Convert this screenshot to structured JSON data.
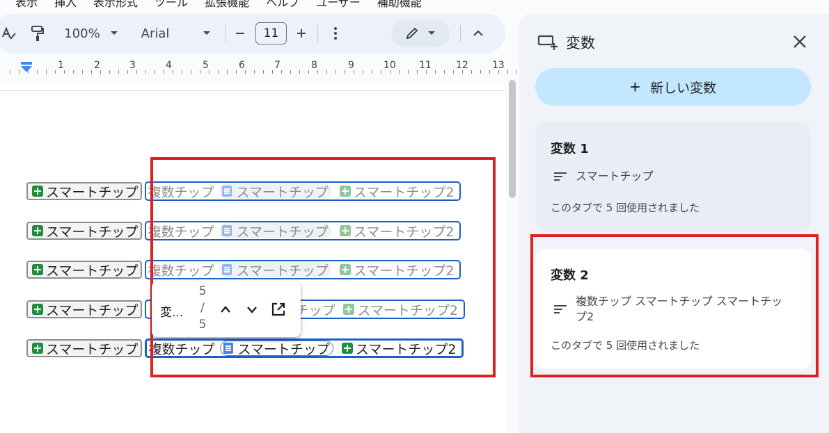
{
  "menu": [
    "表示",
    "挿入",
    "表示形式",
    "ツール",
    "拡張機能",
    "ヘルプ",
    "ユーザー",
    "補助機能"
  ],
  "toolbar": {
    "zoom": "100%",
    "font": "Arial",
    "font_size": "11",
    "icons": [
      "spellcheck-icon",
      "paint-format-icon",
      "minus-icon",
      "plus-icon",
      "more-vert-icon",
      "pencil-icon",
      "chevron-up-icon"
    ]
  },
  "ruler": {
    "numbers": [
      "1",
      "2",
      "3",
      "4",
      "5",
      "6",
      "7",
      "8",
      "9",
      "10",
      "11",
      "12",
      "13"
    ]
  },
  "document": {
    "rows": [
      {
        "chip": "スマートチップ",
        "multi": "複数チップ",
        "sub1": "スマートチップ",
        "sub2": "スマートチップ2"
      },
      {
        "chip": "スマートチップ",
        "multi": "複数チップ",
        "sub1": "スマートチップ",
        "sub2": "スマートチップ2"
      },
      {
        "chip": "スマートチップ",
        "multi": "複数チップ",
        "sub1": "スマートチップ",
        "sub2": "スマートチップ2"
      },
      {
        "chip": "スマートチップ",
        "multi": "チップ",
        "sub1": "",
        "sub2": "スマートチップ2"
      },
      {
        "chip": "スマートチップ",
        "multi": "複数チップ",
        "sub1": "スマートチップ",
        "sub2": "スマートチップ2"
      }
    ]
  },
  "find_popup": {
    "label": "変...",
    "count_current": "5",
    "count_sep": "/",
    "count_total": "5"
  },
  "panel": {
    "title": "変数",
    "new_button": "新しい変数",
    "variables": [
      {
        "name": "変数 1",
        "value": "スマートチップ",
        "usage": "このタブで 5 回使用されました"
      },
      {
        "name": "変数 2",
        "value_line1": "複数チップ スマートチップ スマートチッ",
        "value_line2": "プ2",
        "usage": "このタブで 5 回使用されました"
      }
    ]
  },
  "colors": {
    "highlight_red": "#e02020",
    "chip_border_blue": "#1a5fc6",
    "new_button_bg": "#c2e7ff",
    "sheets_green": "#1e8e3e",
    "docs_blue": "#4285f4"
  }
}
